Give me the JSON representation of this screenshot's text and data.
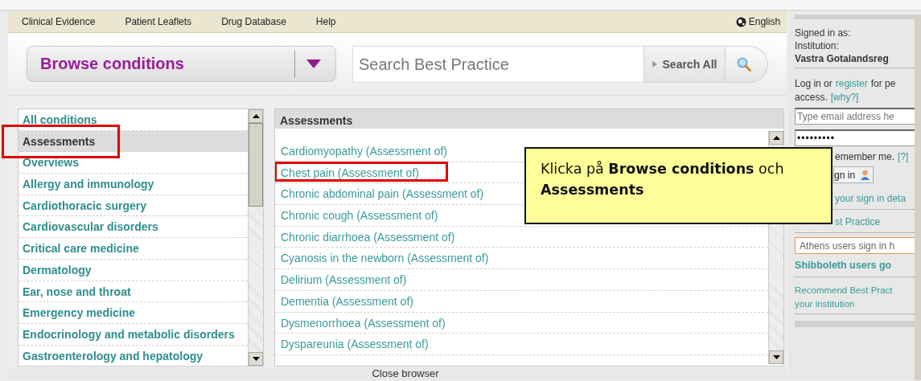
{
  "nav": {
    "links": [
      {
        "label": "Clinical Evidence"
      },
      {
        "label": "Patient Leaflets"
      },
      {
        "label": "Drug Database"
      },
      {
        "label": "Help"
      }
    ],
    "language": "English"
  },
  "browse": {
    "label": "Browse conditions"
  },
  "search": {
    "placeholder": "Search Best Practice",
    "scope_button": "Search All"
  },
  "categories": {
    "items": [
      {
        "label": "All conditions",
        "selected": false,
        "highlighted": false
      },
      {
        "label": "Assessments",
        "selected": true,
        "highlighted": true
      },
      {
        "label": "Overviews",
        "selected": false,
        "highlighted": false
      },
      {
        "label": "Allergy and immunology",
        "selected": false,
        "highlighted": false
      },
      {
        "label": "Cardiothoracic surgery",
        "selected": false,
        "highlighted": false
      },
      {
        "label": "Cardiovascular disorders",
        "selected": false,
        "highlighted": false
      },
      {
        "label": "Critical care medicine",
        "selected": false,
        "highlighted": false
      },
      {
        "label": "Dermatology",
        "selected": false,
        "highlighted": false
      },
      {
        "label": "Ear, nose and throat",
        "selected": false,
        "highlighted": false
      },
      {
        "label": "Emergency medicine",
        "selected": false,
        "highlighted": false
      },
      {
        "label": "Endocrinology and metabolic disorders",
        "selected": false,
        "highlighted": false
      },
      {
        "label": "Gastroenterology and hepatology",
        "selected": false,
        "highlighted": false
      }
    ]
  },
  "results": {
    "title": "Assessments",
    "items": [
      {
        "label": "Cardiomyopathy (Assessment of)",
        "highlighted": false
      },
      {
        "label": "Chest pain (Assessment of)",
        "highlighted": true
      },
      {
        "label": "Chronic abdominal pain (Assessment of)",
        "highlighted": false
      },
      {
        "label": "Chronic cough (Assessment of)",
        "highlighted": false
      },
      {
        "label": "Chronic diarrhoea (Assessment of)",
        "highlighted": false
      },
      {
        "label": "Cyanosis in the newborn (Assessment of)",
        "highlighted": false
      },
      {
        "label": "Delirium (Assessment of)",
        "highlighted": false
      },
      {
        "label": "Dementia (Assessment of)",
        "highlighted": false
      },
      {
        "label": "Dysmenorrhoea (Assessment of)",
        "highlighted": false
      },
      {
        "label": "Dyspareunia (Assessment of)",
        "highlighted": false
      }
    ]
  },
  "close_browser": "Close browser",
  "callout": {
    "text": "Klicka på **Browse conditions** och **Assessments**"
  },
  "account": {
    "signed_in_label": "Signed in as:",
    "institution_label": "Institution:",
    "institution": "Vastra Gotalandsreg",
    "login_prefix": "Log in or",
    "register_link": "register",
    "login_suffix": "for pe",
    "access_text": "access.",
    "why_link": "[why?]",
    "email_placeholder": "Type email address he",
    "password_value": "•••••••••",
    "remember_label": "emember me.",
    "remember_help": "[?]",
    "sign_in_button": "gn in",
    "forgot_link": "your sign in deta",
    "best_practice_link": "st Practice",
    "athens_button": "Athens users sign in h",
    "shibboleth_link": "Shibboleth users go",
    "recommend_link": "Recommend Best Pract\nyour institution"
  }
}
